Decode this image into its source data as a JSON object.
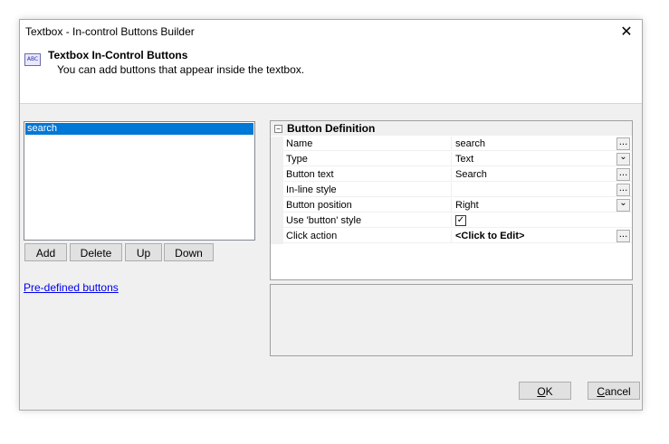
{
  "window": {
    "title": "Textbox - In-control Buttons Builder"
  },
  "header": {
    "icon": "abc-textbox-icon",
    "icon_text": "ABC",
    "title": "Textbox In-Control Buttons",
    "subtitle": "You can add buttons that appear inside the textbox."
  },
  "list": {
    "items": [
      "search"
    ],
    "selected": 0
  },
  "list_buttons": {
    "add": "Add",
    "delete": "Delete",
    "up": "Up",
    "down": "Down"
  },
  "link": {
    "predefined": "Pre-defined buttons"
  },
  "grid": {
    "category": "Button Definition",
    "toggle": "−",
    "rows": [
      {
        "name": "Name",
        "value": "search",
        "editor": "ellipsis"
      },
      {
        "name": "Type",
        "value": "Text",
        "editor": "dropdown"
      },
      {
        "name": "Button text",
        "value": "Search",
        "editor": "ellipsis"
      },
      {
        "name": "In-line style",
        "value": "",
        "editor": "ellipsis"
      },
      {
        "name": "Button position",
        "value": "Right",
        "editor": "dropdown"
      },
      {
        "name": "Use 'button' style",
        "value": "",
        "editor": "checkbox",
        "checked": true
      },
      {
        "name": "Click action",
        "value": "<Click to Edit>",
        "editor": "ellipsis"
      }
    ]
  },
  "footer": {
    "ok_first": "O",
    "ok_rest": "K",
    "cancel_first": "C",
    "cancel_rest": "ancel"
  },
  "glyphs": {
    "close": "✕",
    "ellipsis": "...",
    "dropdown": "⌄",
    "check": "✓"
  }
}
